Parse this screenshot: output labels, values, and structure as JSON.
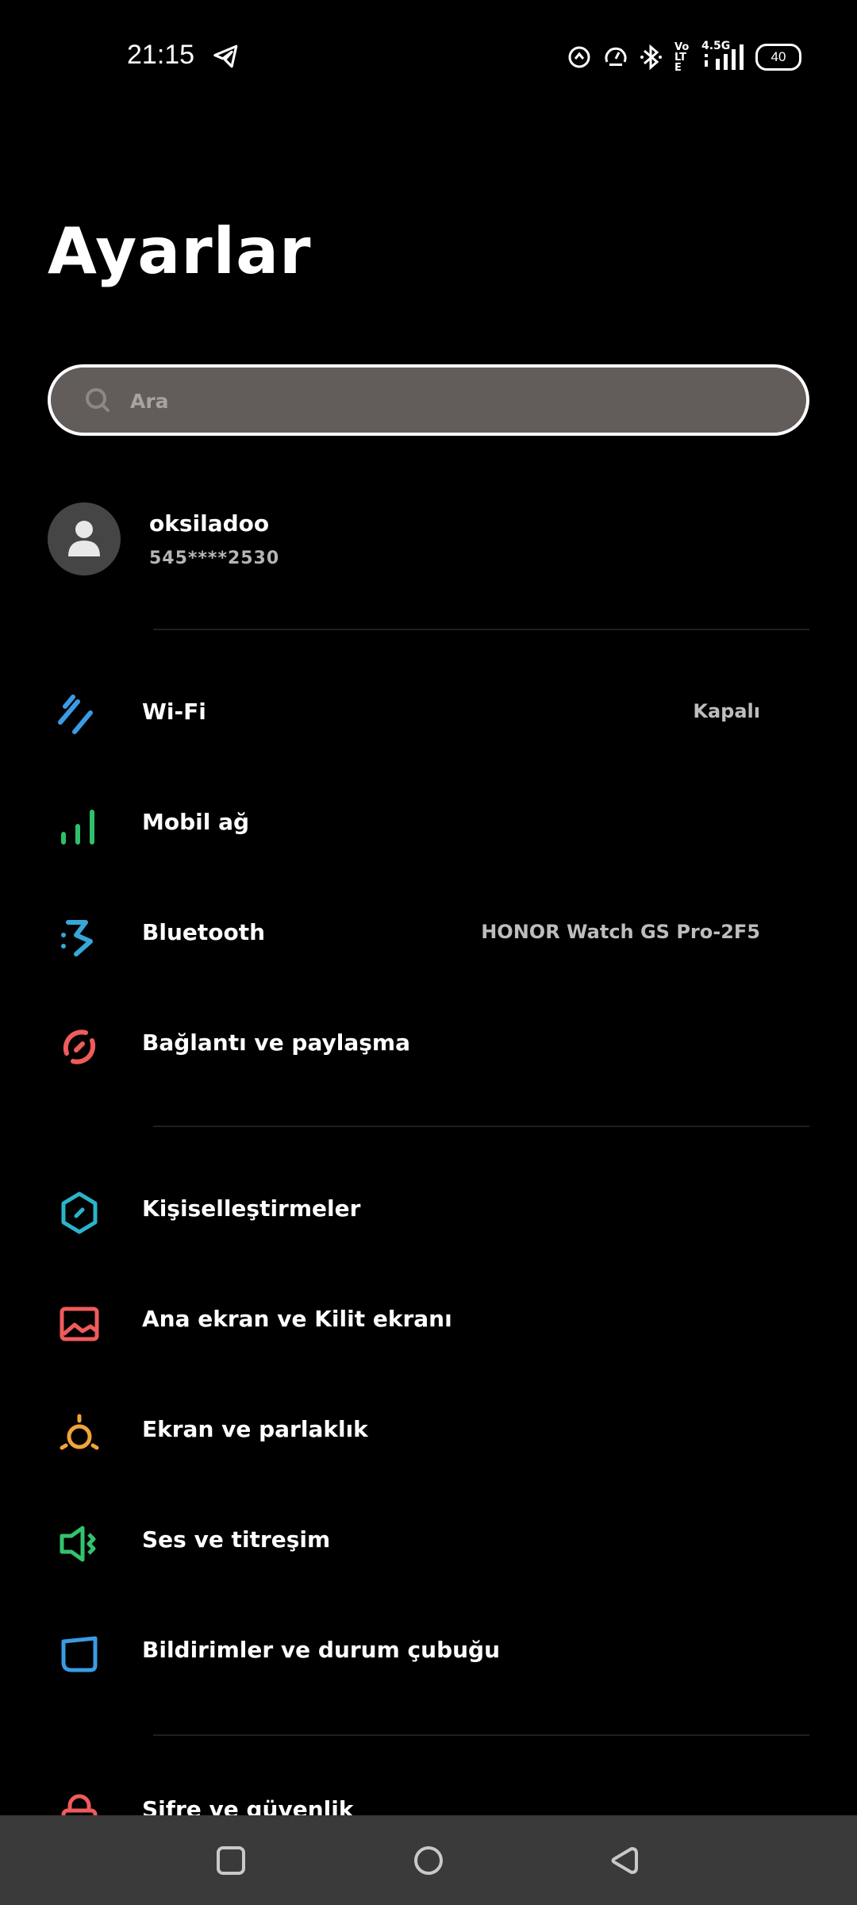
{
  "status_bar": {
    "time": "21:15",
    "network_label": "4.5G",
    "volte_label": "Vo LTE",
    "battery": "40"
  },
  "page": {
    "title": "Ayarlar"
  },
  "search": {
    "placeholder": "Ara"
  },
  "account": {
    "name": "oksiladoo",
    "phone": "545****2530"
  },
  "sections": [
    {
      "items": [
        {
          "label": "Wi-Fi",
          "value": "Kapalı",
          "icon": "wifi-icon",
          "color": "#3a9be4"
        },
        {
          "label": "Mobil ağ",
          "value": "",
          "icon": "mobile-network-icon",
          "color": "#2fbf6a"
        },
        {
          "label": "Bluetooth",
          "value": "HONOR Watch GS Pro-2F5",
          "icon": "bluetooth-icon",
          "color": "#36a7d8"
        },
        {
          "label": "Bağlantı ve paylaşma",
          "value": "",
          "icon": "connection-sharing-icon",
          "color": "#ef5b5b"
        }
      ]
    },
    {
      "items": [
        {
          "label": "Kişiselleştirmeler",
          "value": "",
          "icon": "personalization-icon",
          "color": "#2bb3c9"
        },
        {
          "label": "Ana ekran ve Kilit ekranı",
          "value": "",
          "icon": "wallpaper-icon",
          "color": "#ef5b5b"
        },
        {
          "label": "Ekran ve parlaklık",
          "value": "",
          "icon": "brightness-icon",
          "color": "#f2a33a"
        },
        {
          "label": "Ses ve titreşim",
          "value": "",
          "icon": "sound-vibration-icon",
          "color": "#34c26c"
        },
        {
          "label": "Bildirimler ve durum çubuğu",
          "value": "",
          "icon": "notifications-icon",
          "color": "#3a9be4"
        }
      ]
    }
  ],
  "partial_item": {
    "label": "Şifre ve güvenlik",
    "icon": "lock-icon",
    "color": "#ef5b5b"
  }
}
